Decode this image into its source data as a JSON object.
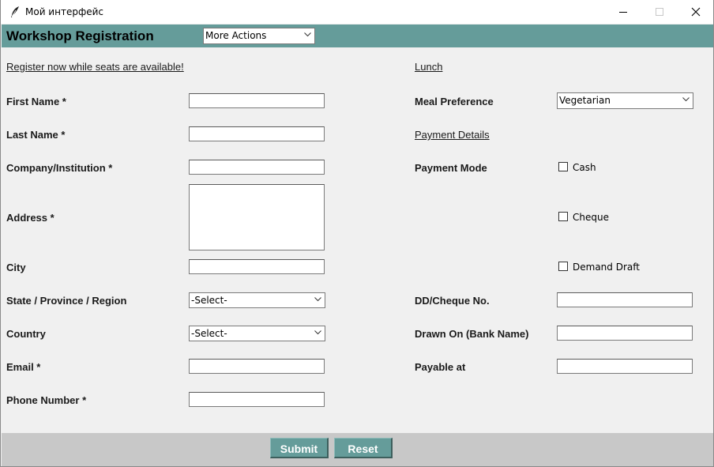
{
  "window": {
    "title": "Мой интерфейс",
    "icon": "feather-icon"
  },
  "header": {
    "title": "Workshop Registration",
    "actions_value": "More Actions"
  },
  "left": {
    "intro_link": "Register now while seats are available!",
    "first_name_label": "First Name *",
    "last_name_label": "Last Name *",
    "company_label": "Company/Institution *",
    "address_label": "Address *",
    "city_label": "City",
    "state_label": "State / Province / Region",
    "state_value": "-Select-",
    "country_label": "Country",
    "country_value": "-Select-",
    "email_label": "Email *",
    "phone_label": "Phone Number *",
    "first_name_value": "",
    "last_name_value": "",
    "company_value": "",
    "address_value": "",
    "city_value": "",
    "email_value": "",
    "phone_value": ""
  },
  "right": {
    "lunch_link": "Lunch",
    "meal_label": "Meal Preference",
    "meal_value": "Vegetarian",
    "payment_link": "Payment Details",
    "payment_mode_label": "Payment Mode",
    "payment_options": [
      {
        "label": "Cash",
        "checked": false
      },
      {
        "label": "Cheque",
        "checked": false
      },
      {
        "label": "Demand Draft",
        "checked": false
      }
    ],
    "dd_label": "DD/Cheque No.",
    "drawn_label": "Drawn On (Bank Name)",
    "payable_label": "Payable at",
    "dd_value": "",
    "drawn_value": "",
    "payable_value": ""
  },
  "footer": {
    "submit_label": "Submit",
    "reset_label": "Reset"
  },
  "colors": {
    "accent": "#659c9a",
    "window_bg": "#f0f0f0",
    "footer_bg": "#c8c8c8"
  }
}
